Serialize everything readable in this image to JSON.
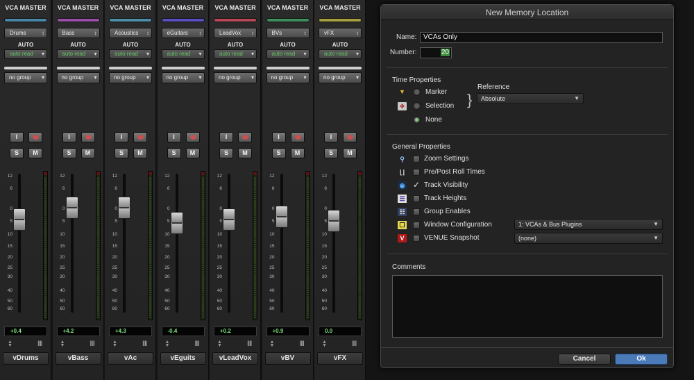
{
  "mixer": {
    "strips": [
      {
        "header": "VCA MASTER",
        "color": "#4a86a6",
        "selector": "Drums",
        "auto_label": "AUTO",
        "auto_mode": "auto read",
        "group": "no group",
        "input_btn": "I",
        "solo_btn": "S",
        "mute_btn": "M",
        "volume": "+0.4",
        "level": 0.55,
        "track": "vDrums"
      },
      {
        "header": "VCA MASTER",
        "color": "#9b4fa8",
        "selector": "Bass",
        "auto_label": "AUTO",
        "auto_mode": "auto read",
        "group": "no group",
        "input_btn": "I",
        "solo_btn": "S",
        "mute_btn": "M",
        "volume": "+4.2",
        "level": 0.7,
        "track": "vBass"
      },
      {
        "header": "VCA MASTER",
        "color": "#4d8ea8",
        "selector": "Acoustics",
        "auto_label": "AUTO",
        "auto_mode": "auto read",
        "group": "no group",
        "input_btn": "I",
        "solo_btn": "S",
        "mute_btn": "M",
        "volume": "+4.3",
        "level": 0.7,
        "track": "vAc"
      },
      {
        "header": "VCA MASTER",
        "color": "#5a4fc0",
        "selector": "eGuitars",
        "auto_label": "AUTO",
        "auto_mode": "auto read",
        "group": "no group",
        "input_btn": "I",
        "solo_btn": "S",
        "mute_btn": "M",
        "volume": "-0.4",
        "level": 0.5,
        "track": "vEguits"
      },
      {
        "header": "VCA MASTER",
        "color": "#b84a58",
        "selector": "LeadVox",
        "auto_label": "AUTO",
        "auto_mode": "auto read",
        "group": "no group",
        "input_btn": "I",
        "solo_btn": "S",
        "mute_btn": "M",
        "volume": "+0.2",
        "level": 0.55,
        "track": "vLeadVox"
      },
      {
        "header": "VCA MASTER",
        "color": "#3e8e5e",
        "selector": "BVs",
        "auto_label": "AUTO",
        "auto_mode": "auto read",
        "group": "no group",
        "input_btn": "I",
        "solo_btn": "S",
        "mute_btn": "M",
        "volume": "+0.9",
        "level": 0.58,
        "track": "vBV"
      },
      {
        "header": "VCA MASTER",
        "color": "#a8a040",
        "selector": "vFX",
        "auto_label": "AUTO",
        "auto_mode": "auto read",
        "group": "no group",
        "input_btn": "I",
        "solo_btn": "S",
        "mute_btn": "M",
        "volume": "0.0",
        "level": 0.53,
        "track": "vFX"
      }
    ],
    "scale_labels": [
      "12",
      "6",
      "0",
      "5",
      "10",
      "15",
      "20",
      "25",
      "30",
      "40",
      "50",
      "60"
    ]
  },
  "dialog": {
    "title": "New Memory Location",
    "name_label": "Name:",
    "name_value": "VCAs Only",
    "number_label": "Number:",
    "number_value": "20",
    "time_properties": {
      "heading": "Time Properties",
      "options": [
        "Marker",
        "Selection",
        "None"
      ],
      "selected": "None",
      "reference_label": "Reference",
      "reference_value": "Absolute"
    },
    "general_properties": {
      "heading": "General Properties",
      "items": [
        {
          "label": "Zoom Settings",
          "checked": false,
          "icon": "magnifier-icon"
        },
        {
          "label": "Pre/Post Roll Times",
          "checked": false,
          "icon": "pre-post-roll-icon"
        },
        {
          "label": "Track Visibility",
          "checked": true,
          "icon": "eye-icon"
        },
        {
          "label": "Track Heights",
          "checked": false,
          "icon": "track-heights-icon"
        },
        {
          "label": "Group Enables",
          "checked": false,
          "icon": "group-enables-icon"
        },
        {
          "label": "Window Configuration",
          "checked": false,
          "icon": "window-config-icon"
        },
        {
          "label": "VENUE Snapshot",
          "checked": false,
          "icon": "venue-icon"
        }
      ],
      "window_config_value": "1: VCAs & Bus Plugins",
      "venue_snapshot_value": "(none)"
    },
    "comments_label": "Comments",
    "comments_value": "",
    "cancel_label": "Cancel",
    "ok_label": "Ok",
    "ok_color": "#4a7ab8"
  }
}
